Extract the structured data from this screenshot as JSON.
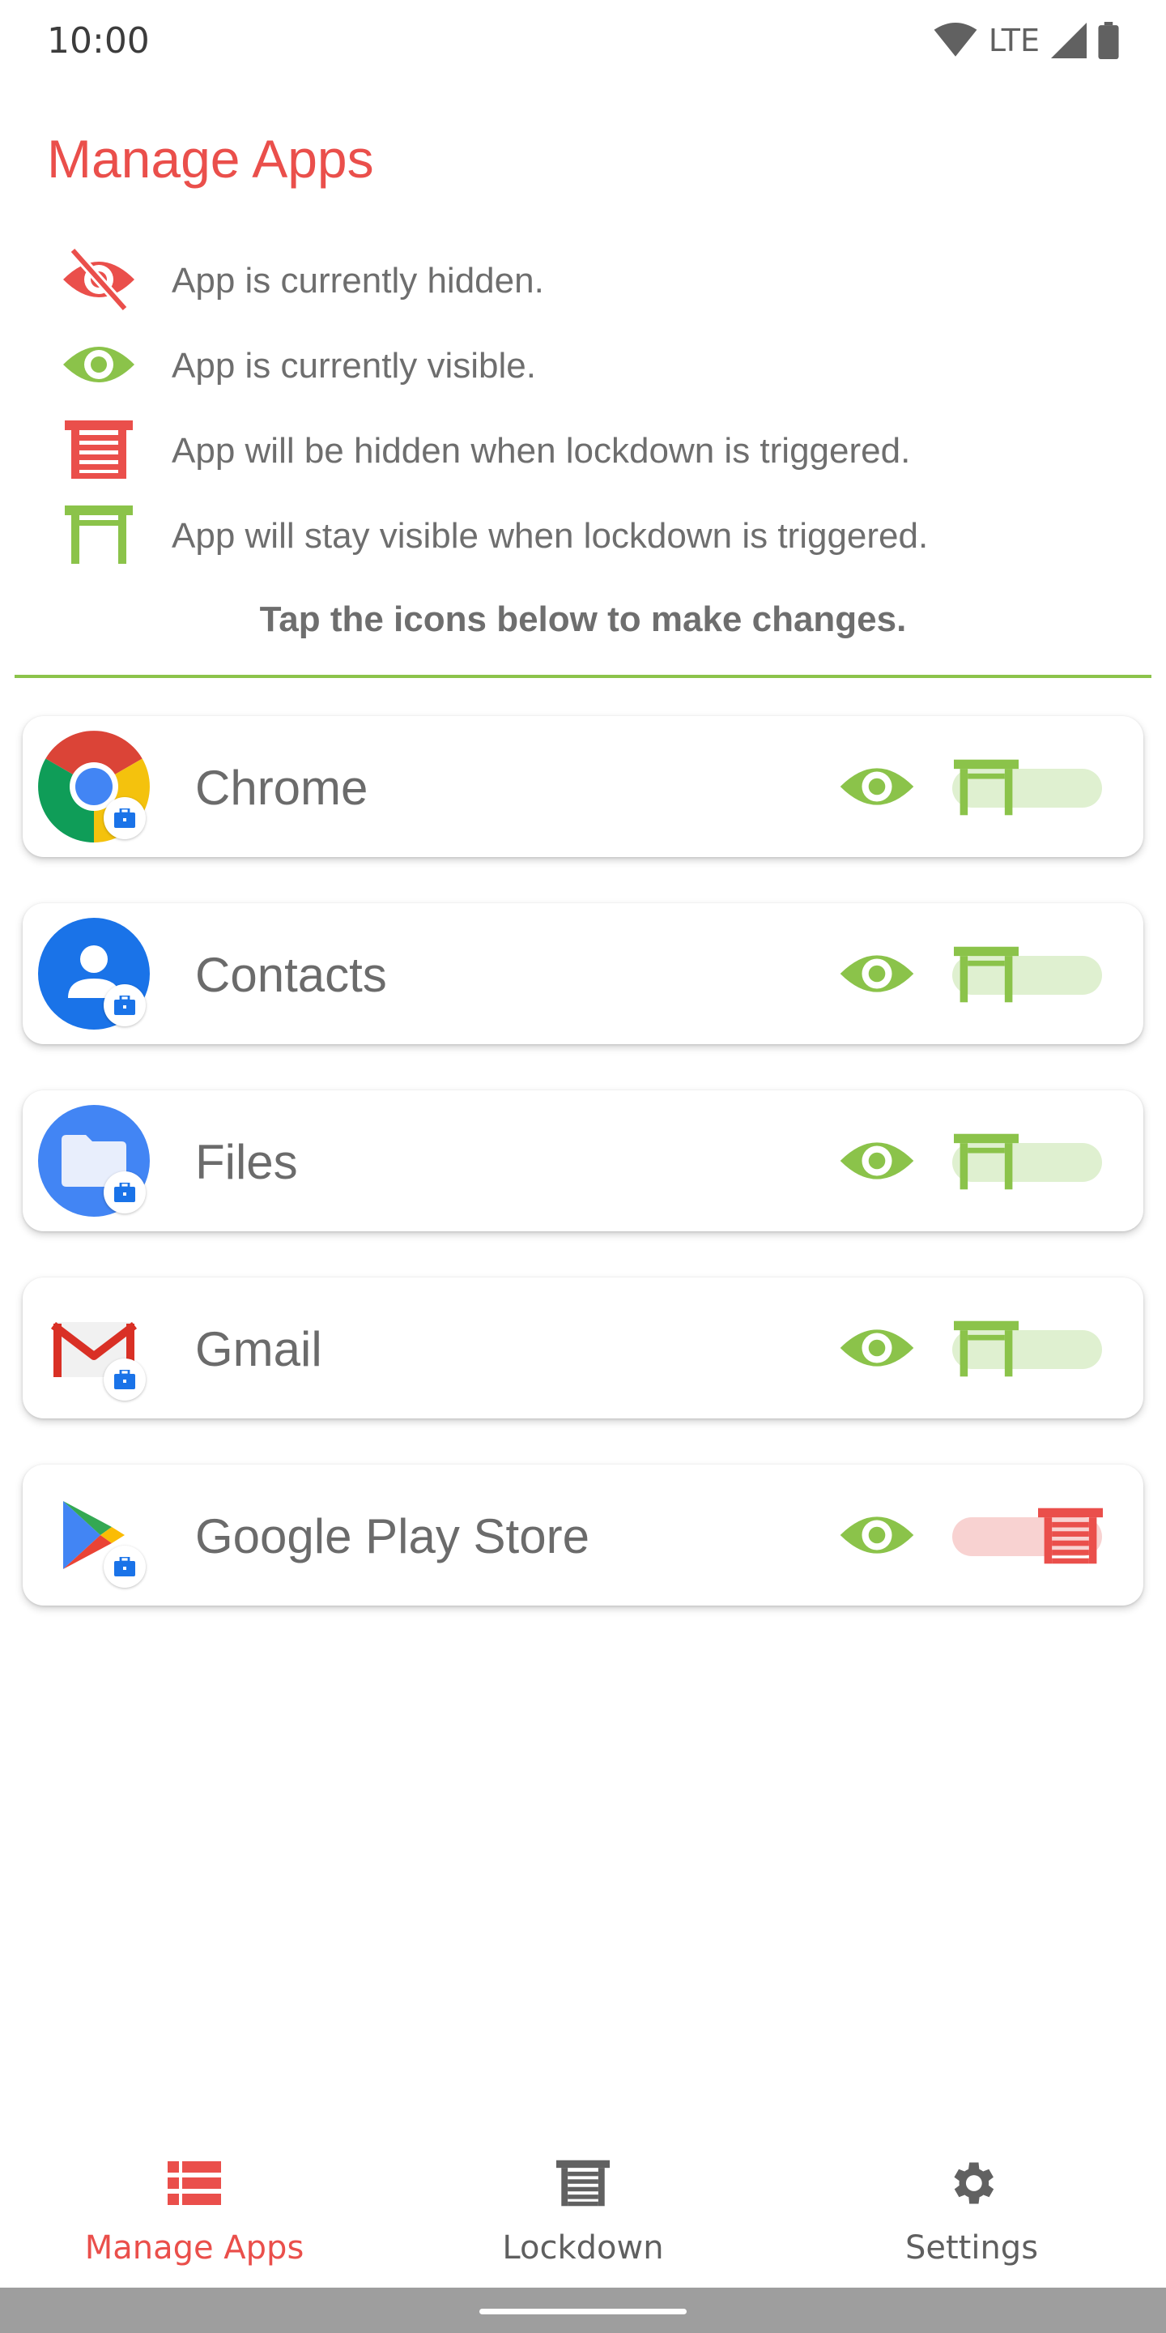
{
  "status_bar": {
    "time": "10:00",
    "network": "LTE"
  },
  "title": "Manage Apps",
  "legend": [
    {
      "icon": "eye-off-icon",
      "text": "App is currently hidden."
    },
    {
      "icon": "eye-icon",
      "text": "App is currently visible."
    },
    {
      "icon": "lockdown-hide-icon",
      "text": "App will be hidden when lockdown is triggered."
    },
    {
      "icon": "lockdown-stay-icon",
      "text": "App will stay visible when lockdown is triggered."
    }
  ],
  "hint": "Tap the icons below to make changes.",
  "apps": [
    {
      "name": "Chrome",
      "icon": "chrome-icon",
      "visible": true,
      "hide_on_lockdown": false
    },
    {
      "name": "Contacts",
      "icon": "contacts-icon",
      "visible": true,
      "hide_on_lockdown": false
    },
    {
      "name": "Files",
      "icon": "files-icon",
      "visible": true,
      "hide_on_lockdown": false
    },
    {
      "name": "Gmail",
      "icon": "gmail-icon",
      "visible": true,
      "hide_on_lockdown": false
    },
    {
      "name": "Google Play Store",
      "icon": "play-store-icon",
      "visible": true,
      "hide_on_lockdown": true
    }
  ],
  "bottom_nav": [
    {
      "label": "Manage Apps",
      "icon": "list-icon",
      "active": true
    },
    {
      "label": "Lockdown",
      "icon": "lockdown-icon",
      "active": false
    },
    {
      "label": "Settings",
      "icon": "gear-icon",
      "active": false
    }
  ],
  "colors": {
    "accent_red": "#ea4f4b",
    "accent_green": "#8bc34a",
    "text_gray": "#6e6e6e"
  }
}
